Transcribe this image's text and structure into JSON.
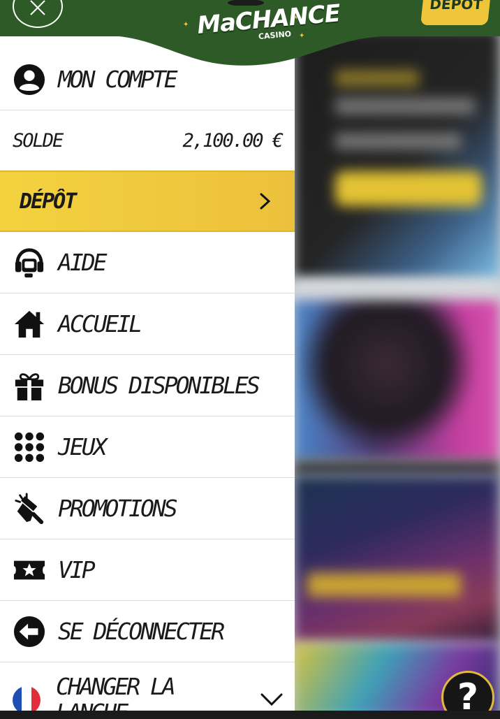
{
  "header": {
    "logo_text": "MaCHANCE",
    "logo_sub": "CASINO",
    "depot_button": "DÉPÔT"
  },
  "menu": {
    "account": "MON COMPTE",
    "balance_label": "SOLDE",
    "balance_value": "2,100.00 €",
    "depot": "DÉPÔT",
    "help": "AIDE",
    "home": "ACCUEIL",
    "bonus": "BONUS DISPONIBLES",
    "games": "JEUX",
    "promotions": "PROMOTIONS",
    "vip": "VIP",
    "logout": "SE DÉCONNECTER",
    "language_line1": "CHANGER LA",
    "language_line2": "LANGUE"
  },
  "help_button": "?",
  "colors": {
    "header_green": "#2d5a27",
    "depot_yellow": "#f2ca3e",
    "text_dark": "#1a1a1a"
  },
  "icons": {
    "close": "close-icon",
    "account": "user-circle-icon",
    "depot": "chevron-right-icon",
    "help": "headset-icon",
    "home": "home-icon",
    "bonus": "gift-icon",
    "games": "dots-grid-icon",
    "promotions": "megaphone-icon",
    "vip": "ticket-star-icon",
    "logout": "logout-arrow-icon",
    "language": "flag-fr-icon",
    "language_toggle": "chevron-down-icon"
  }
}
